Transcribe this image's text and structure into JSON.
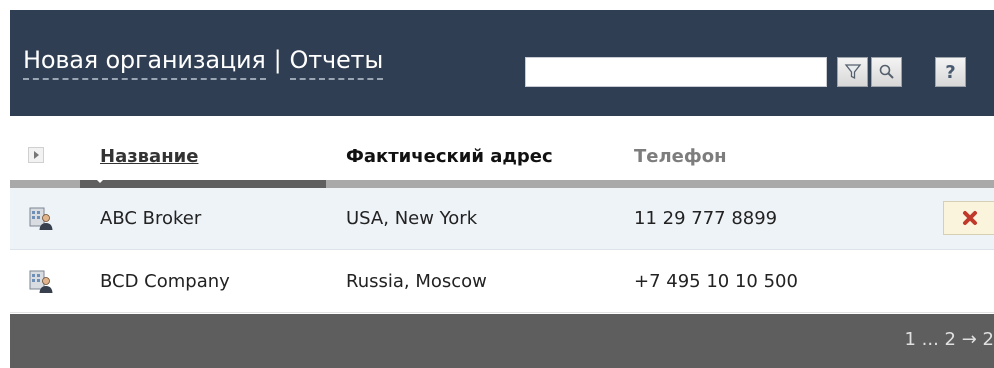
{
  "header": {
    "title_link": "Новая организация",
    "separator": "|",
    "reports_link": "Отчеты",
    "search_value": "",
    "help_label": "?"
  },
  "icons": [
    "filter-icon",
    "search-icon",
    "help-icon",
    "expand-icon",
    "organization-icon",
    "delete-icon"
  ],
  "table": {
    "columns": [
      "Название",
      "Фактический адрес",
      "Телефон"
    ],
    "rows": [
      {
        "name": "ABC Broker",
        "address": "USA, New York",
        "phone": "11 29 777 8899"
      },
      {
        "name": "BCD Company",
        "address": "Russia, Moscow",
        "phone": "+7 495 10 10 500"
      }
    ]
  },
  "footer": {
    "pager": "1 ... 2 → 2"
  },
  "colors": {
    "header_bg": "#2f3e52",
    "selected_row_bg": "#eef3f8",
    "footer_bg": "#5e5e5e",
    "delete_red": "#c0392b"
  }
}
